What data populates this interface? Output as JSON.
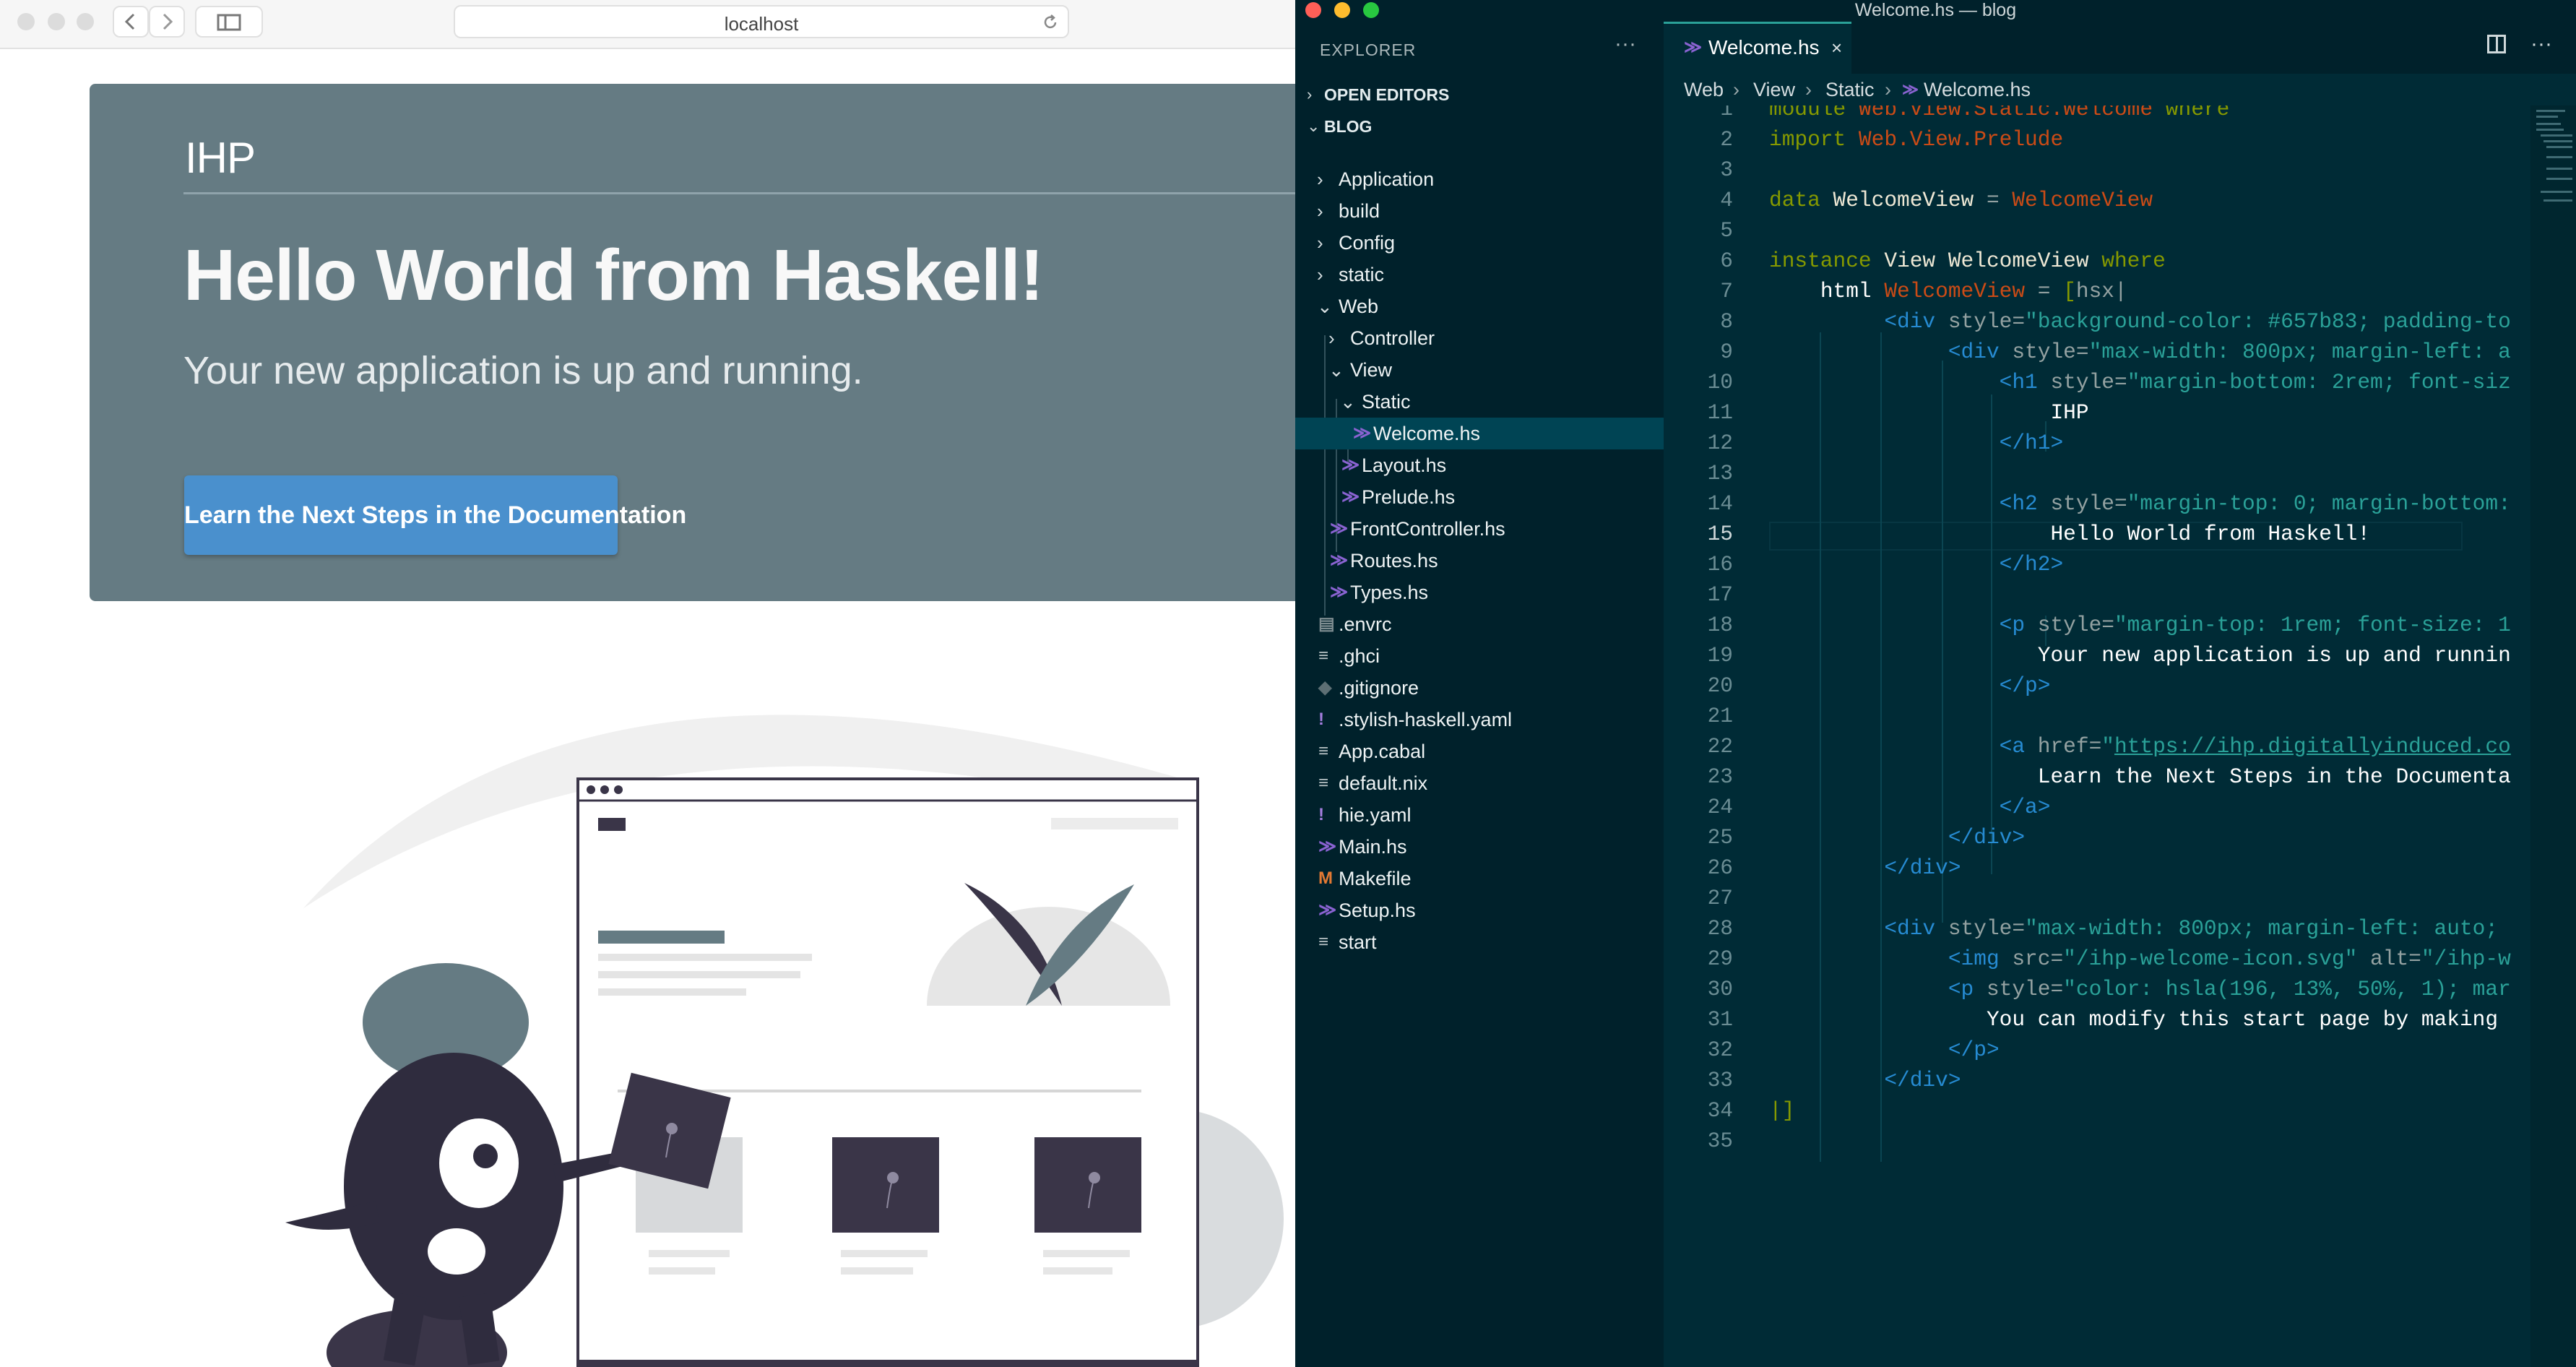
{
  "browser": {
    "url": "localhost",
    "hero": {
      "logo": "IHP",
      "title": "Hello World from Haskell!",
      "subtitle": "Your new application is up and running.",
      "button_label": "Learn the Next Steps in the Documentation",
      "background": "#657b83",
      "button_color": "#4a90cd"
    }
  },
  "vscode": {
    "window_title": "Welcome.hs — blog",
    "explorer": {
      "title": "EXPLORER",
      "sections": {
        "open_editors": "OPEN EDITORS",
        "project": "BLOG"
      },
      "tree": [
        {
          "name": "Application",
          "type": "folder",
          "depth": 1,
          "expanded": false
        },
        {
          "name": "build",
          "type": "folder",
          "depth": 1,
          "expanded": false
        },
        {
          "name": "Config",
          "type": "folder",
          "depth": 1,
          "expanded": false
        },
        {
          "name": "static",
          "type": "folder",
          "depth": 1,
          "expanded": false
        },
        {
          "name": "Web",
          "type": "folder",
          "depth": 1,
          "expanded": true
        },
        {
          "name": "Controller",
          "type": "folder",
          "depth": 2,
          "expanded": false
        },
        {
          "name": "View",
          "type": "folder",
          "depth": 2,
          "expanded": true
        },
        {
          "name": "Static",
          "type": "folder",
          "depth": 3,
          "expanded": true
        },
        {
          "name": "Welcome.hs",
          "type": "haskell",
          "depth": 4,
          "selected": true
        },
        {
          "name": "Layout.hs",
          "type": "haskell",
          "depth": 3
        },
        {
          "name": "Prelude.hs",
          "type": "haskell",
          "depth": 3
        },
        {
          "name": "FrontController.hs",
          "type": "haskell",
          "depth": 2
        },
        {
          "name": "Routes.hs",
          "type": "haskell",
          "depth": 2
        },
        {
          "name": "Types.hs",
          "type": "haskell",
          "depth": 2
        },
        {
          "name": ".envrc",
          "type": "env",
          "depth": 1
        },
        {
          "name": ".ghci",
          "type": "lines",
          "depth": 1
        },
        {
          "name": ".gitignore",
          "type": "git",
          "depth": 1
        },
        {
          "name": ".stylish-haskell.yaml",
          "type": "yaml",
          "depth": 1
        },
        {
          "name": "App.cabal",
          "type": "lines",
          "depth": 1
        },
        {
          "name": "default.nix",
          "type": "lines",
          "depth": 1
        },
        {
          "name": "hie.yaml",
          "type": "yaml",
          "depth": 1
        },
        {
          "name": "Main.hs",
          "type": "haskell",
          "depth": 1
        },
        {
          "name": "Makefile",
          "type": "make",
          "depth": 1
        },
        {
          "name": "Setup.hs",
          "type": "haskell",
          "depth": 1
        },
        {
          "name": "start",
          "type": "lines",
          "depth": 1
        }
      ]
    },
    "editor": {
      "tab_label": "Welcome.hs",
      "breadcrumb": [
        "Web",
        "View",
        "Static",
        "Welcome.hs"
      ],
      "current_line": 15,
      "lines": [
        {
          "n": 1,
          "tokens": [
            [
              "k",
              "module"
            ],
            [
              "a",
              " "
            ],
            [
              "t",
              "Web.View.Static.Welcome"
            ],
            [
              "a",
              " "
            ],
            [
              "k",
              "where"
            ]
          ]
        },
        {
          "n": 2,
          "tokens": [
            [
              "k",
              "import"
            ],
            [
              "a",
              " "
            ],
            [
              "t",
              "Web.View.Prelude"
            ]
          ]
        },
        {
          "n": 3,
          "tokens": []
        },
        {
          "n": 4,
          "tokens": [
            [
              "k",
              "data"
            ],
            [
              "a",
              " "
            ],
            [
              "p",
              "WelcomeView"
            ],
            [
              "a",
              " = "
            ],
            [
              "t",
              "WelcomeView"
            ]
          ]
        },
        {
          "n": 5,
          "tokens": []
        },
        {
          "n": 6,
          "tokens": [
            [
              "k",
              "instance"
            ],
            [
              "a",
              " "
            ],
            [
              "p",
              "View WelcomeView"
            ],
            [
              "a",
              " "
            ],
            [
              "k",
              "where"
            ]
          ]
        },
        {
          "n": 7,
          "tokens": [
            [
              "a",
              "    "
            ],
            [
              "w",
              "html"
            ],
            [
              "a",
              " "
            ],
            [
              "t",
              "WelcomeView"
            ],
            [
              "a",
              " = "
            ],
            [
              "k",
              "["
            ],
            [
              "a",
              "hsx|"
            ]
          ]
        },
        {
          "n": 8,
          "tokens": [
            [
              "a",
              "         "
            ],
            [
              "h",
              "<div"
            ],
            [
              "a",
              " style="
            ],
            [
              "s",
              "\"background-color: #657b83; padding-to"
            ]
          ]
        },
        {
          "n": 9,
          "tokens": [
            [
              "a",
              "              "
            ],
            [
              "h",
              "<div"
            ],
            [
              "a",
              " style="
            ],
            [
              "s",
              "\"max-width: 800px; margin-left: a"
            ]
          ]
        },
        {
          "n": 10,
          "tokens": [
            [
              "a",
              "                  "
            ],
            [
              "h",
              "<h1"
            ],
            [
              "a",
              " style="
            ],
            [
              "s",
              "\"margin-bottom: 2rem; font-siz"
            ]
          ]
        },
        {
          "n": 11,
          "tokens": [
            [
              "a",
              "                      "
            ],
            [
              "w",
              "IHP"
            ]
          ]
        },
        {
          "n": 12,
          "tokens": [
            [
              "a",
              "                  "
            ],
            [
              "h",
              "</h1>"
            ]
          ]
        },
        {
          "n": 13,
          "tokens": []
        },
        {
          "n": 14,
          "tokens": [
            [
              "a",
              "                  "
            ],
            [
              "h",
              "<h2"
            ],
            [
              "a",
              " style="
            ],
            [
              "s",
              "\"margin-top: 0; margin-bottom:"
            ]
          ]
        },
        {
          "n": 15,
          "tokens": [
            [
              "a",
              "                      "
            ],
            [
              "w",
              "Hello World from Haskell!"
            ]
          ]
        },
        {
          "n": 16,
          "tokens": [
            [
              "a",
              "                  "
            ],
            [
              "h",
              "</h2>"
            ]
          ]
        },
        {
          "n": 17,
          "tokens": []
        },
        {
          "n": 18,
          "tokens": [
            [
              "a",
              "                  "
            ],
            [
              "h",
              "<p"
            ],
            [
              "a",
              " style="
            ],
            [
              "s",
              "\"margin-top: 1rem; font-size: 1"
            ]
          ]
        },
        {
          "n": 19,
          "tokens": [
            [
              "a",
              "                     "
            ],
            [
              "w",
              "Your new application is up and runnin"
            ]
          ]
        },
        {
          "n": 20,
          "tokens": [
            [
              "a",
              "                  "
            ],
            [
              "h",
              "</p>"
            ]
          ]
        },
        {
          "n": 21,
          "tokens": []
        },
        {
          "n": 22,
          "tokens": [
            [
              "a",
              "                  "
            ],
            [
              "h",
              "<a"
            ],
            [
              "a",
              " href="
            ],
            [
              "s",
              "\""
            ],
            [
              "u",
              "https://ihp.digitallyinduced.co"
            ]
          ]
        },
        {
          "n": 23,
          "tokens": [
            [
              "a",
              "                     "
            ],
            [
              "w",
              "Learn the Next Steps in the Documenta"
            ]
          ]
        },
        {
          "n": 24,
          "tokens": [
            [
              "a",
              "                  "
            ],
            [
              "h",
              "</a>"
            ]
          ]
        },
        {
          "n": 25,
          "tokens": [
            [
              "a",
              "              "
            ],
            [
              "h",
              "</div>"
            ]
          ]
        },
        {
          "n": 26,
          "tokens": [
            [
              "a",
              "         "
            ],
            [
              "h",
              "</div>"
            ]
          ]
        },
        {
          "n": 27,
          "tokens": []
        },
        {
          "n": 28,
          "tokens": [
            [
              "a",
              "         "
            ],
            [
              "h",
              "<div"
            ],
            [
              "a",
              " style="
            ],
            [
              "s",
              "\"max-width: 800px; margin-left: auto;"
            ]
          ]
        },
        {
          "n": 29,
          "tokens": [
            [
              "a",
              "              "
            ],
            [
              "h",
              "<img"
            ],
            [
              "a",
              " src="
            ],
            [
              "s",
              "\"/ihp-welcome-icon.svg\""
            ],
            [
              "a",
              " alt="
            ],
            [
              "s",
              "\"/ihp-w"
            ]
          ]
        },
        {
          "n": 30,
          "tokens": [
            [
              "a",
              "              "
            ],
            [
              "h",
              "<p"
            ],
            [
              "a",
              " style="
            ],
            [
              "s",
              "\"color: hsla(196, 13%, 50%, 1); mar"
            ]
          ]
        },
        {
          "n": 31,
          "tokens": [
            [
              "a",
              "                 "
            ],
            [
              "w",
              "You can modify this start page by making"
            ]
          ]
        },
        {
          "n": 32,
          "tokens": [
            [
              "a",
              "              "
            ],
            [
              "h",
              "</p>"
            ]
          ]
        },
        {
          "n": 33,
          "tokens": [
            [
              "a",
              "         "
            ],
            [
              "h",
              "</div>"
            ]
          ]
        },
        {
          "n": 34,
          "tokens": [
            [
              "k",
              "|]"
            ]
          ]
        },
        {
          "n": 35,
          "tokens": []
        }
      ]
    },
    "colors": {
      "editor_bg": "#002b36",
      "sidebar_bg": "#00212b",
      "keyword": "#859900",
      "type": "#cb4b16",
      "tag": "#268bd2",
      "string": "#2aa198"
    }
  }
}
